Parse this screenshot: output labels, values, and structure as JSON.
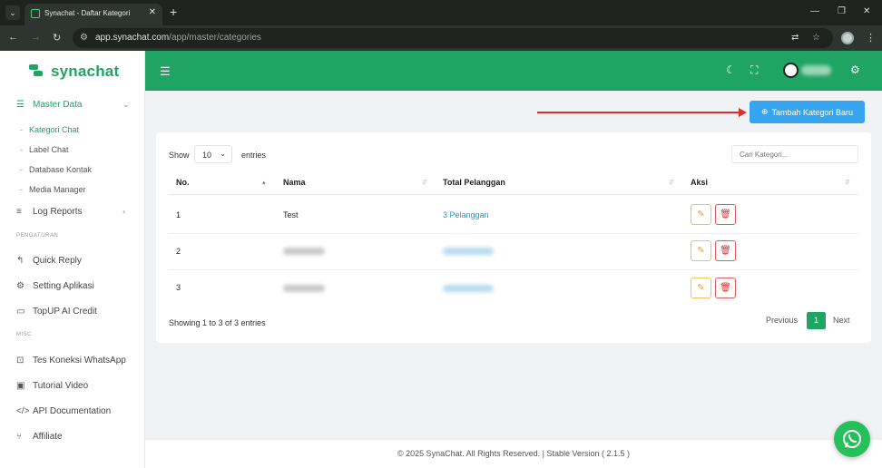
{
  "browser": {
    "tab_title": "Synachat - Daftar Kategori",
    "url_host": "app.synachat.com",
    "url_path": "/app/master/categories"
  },
  "app": {
    "name": "synachat",
    "accent": "#1fa463"
  },
  "sidebar": {
    "groups": [
      {
        "label": "Master Data",
        "icon": "list-icon"
      },
      {
        "label": "Log Reports",
        "icon": "report-icon"
      }
    ],
    "master_items": [
      "Kategori Chat",
      "Label Chat",
      "Database Kontak",
      "Media Manager"
    ],
    "section_pengaturan": "PENGATURAN",
    "pengaturan_items": [
      "Quick Reply",
      "Setting Aplikasi",
      "TopUP AI Credit"
    ],
    "section_misc": "MISC",
    "misc_items": [
      "Tes Koneksi WhatsApp",
      "Tutorial Video",
      "API Documentation",
      "Affiliate"
    ]
  },
  "main": {
    "add_button_label": "Tambah Kategori Baru",
    "show_label": "Show",
    "entries_value": "10",
    "entries_label": "entries",
    "search_placeholder": "Cari Kategori...",
    "columns": [
      "No.",
      "Nama",
      "Total Pelanggan",
      "Aksi"
    ],
    "rows": [
      {
        "no": "1",
        "nama": "Test",
        "total": "3 Pelanggan"
      },
      {
        "no": "2",
        "nama": "",
        "total": ""
      },
      {
        "no": "3",
        "nama": "",
        "total": ""
      }
    ],
    "showing_text": "Showing 1 to 3 of 3 entries",
    "pagination": {
      "previous": "Previous",
      "current": "1",
      "next": "Next"
    }
  },
  "footer": {
    "text": "© 2025 SynaChat. All Rights Reserved. | Stable Version ( 2.1.5 )"
  }
}
